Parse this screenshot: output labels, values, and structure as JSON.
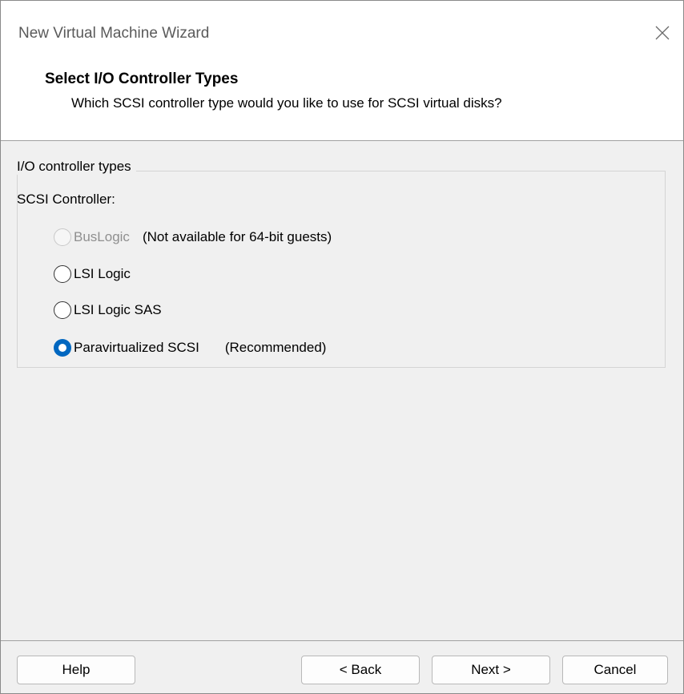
{
  "window": {
    "title": "New Virtual Machine Wizard",
    "close_icon": "close-icon"
  },
  "header": {
    "title": "Select I/O Controller Types",
    "subtitle": "Which SCSI controller type would you like to use for SCSI virtual disks?"
  },
  "group": {
    "legend": "I/O controller types",
    "scsi_label": "SCSI Controller:",
    "options": [
      {
        "label": "BusLogic",
        "note": "(Not available for 64-bit guests)",
        "state": "disabled"
      },
      {
        "label": "LSI Logic",
        "note": "",
        "state": "unselected"
      },
      {
        "label": "LSI Logic SAS",
        "note": "",
        "state": "unselected"
      },
      {
        "label": "Paravirtualized SCSI",
        "note": "(Recommended)",
        "state": "selected"
      }
    ],
    "selected_option": "Paravirtualized SCSI"
  },
  "footer": {
    "help": "Help",
    "back": "< Back",
    "next": "Next >",
    "cancel": "Cancel"
  },
  "colors": {
    "accent": "#0067c0",
    "dialog_bg": "#f0f0f0",
    "header_bg": "#ffffff",
    "disabled_text": "#8f8f8f"
  }
}
